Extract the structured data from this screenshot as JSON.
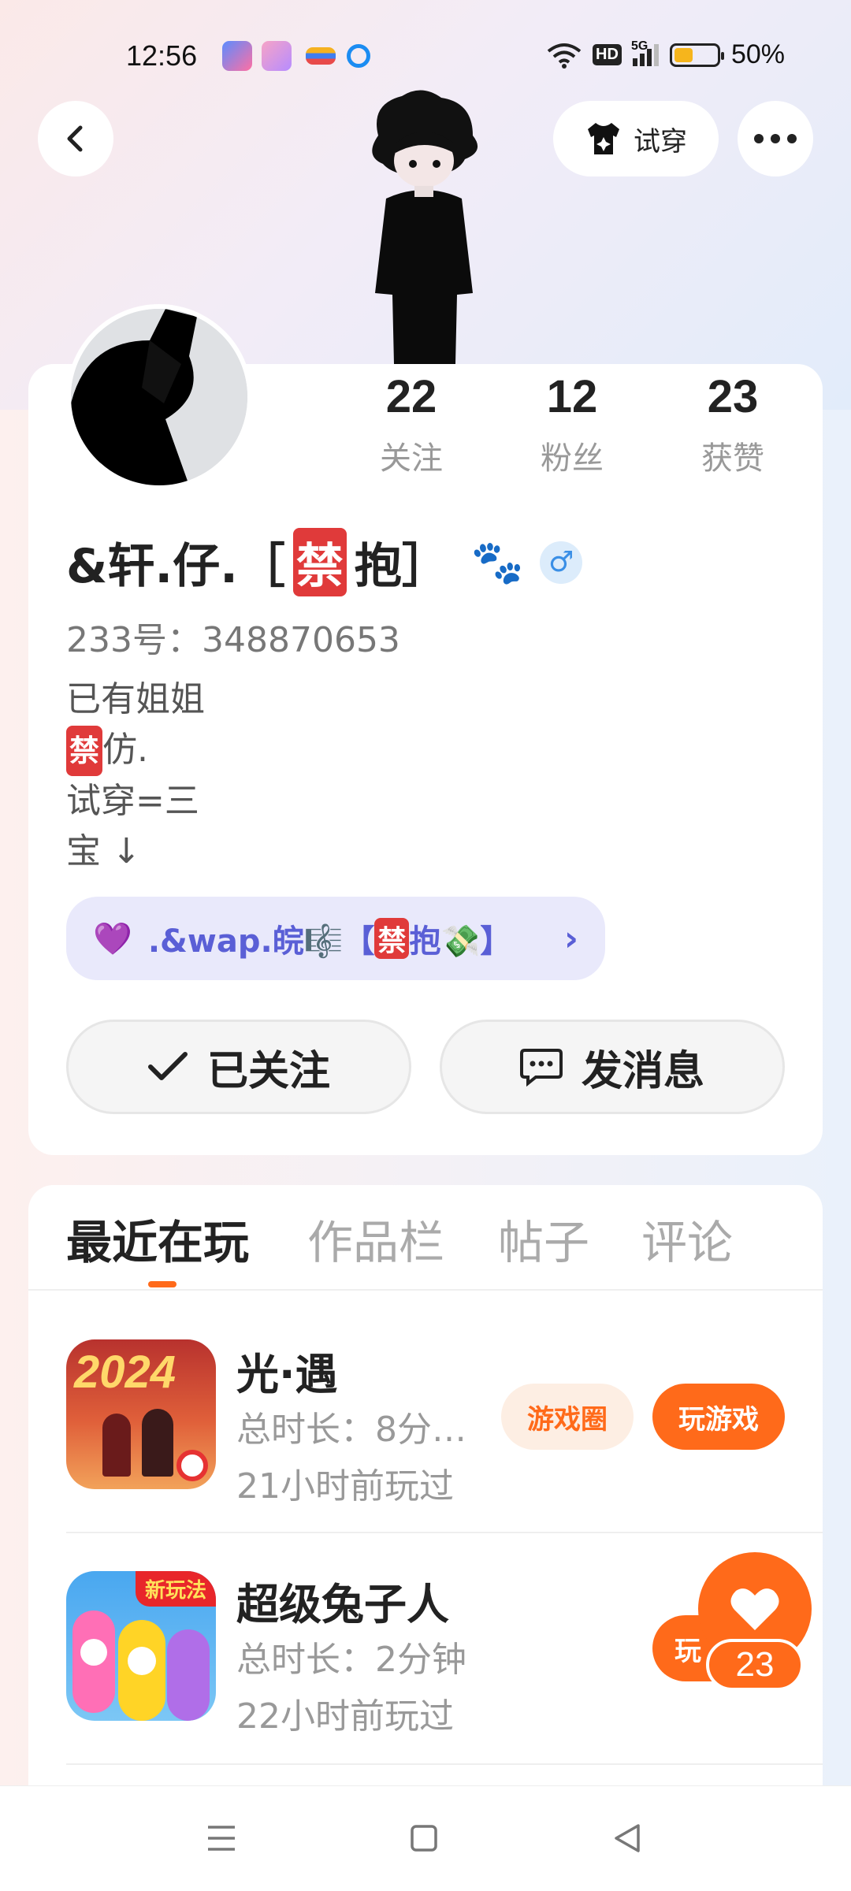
{
  "status_bar": {
    "time": "12:56",
    "network": "5G",
    "hd": "HD",
    "battery_percent": "50%",
    "battery_level": 0.5
  },
  "header": {
    "try_on_label": "试穿"
  },
  "profile": {
    "stats": [
      {
        "count": "22",
        "label": "关注"
      },
      {
        "count": "12",
        "label": "粉丝"
      },
      {
        "count": "23",
        "label": "获赞"
      }
    ],
    "nickname_prefix": "&轩.仔.［",
    "nickname_ban": "禁",
    "nickname_suffix": "抱］",
    "nickname_emoji": "🐾",
    "gender_symbol": "♂",
    "uid": "233号：348870653",
    "bio": {
      "line1": "已有姐姐",
      "line2_ban": "禁",
      "line2_text": "仿.",
      "line3": "试穿=三",
      "line4": "宝 ↓"
    },
    "badge": {
      "heart": "💜",
      "text_before": ".&wap.皖🎼【",
      "ban": "禁",
      "text_after": "抱💸】",
      "chevron": "›"
    },
    "follow_label": "已关注",
    "message_label": "发消息"
  },
  "tabs": [
    "最近在玩",
    "作品栏",
    "帖子",
    "评论"
  ],
  "games": [
    {
      "name": "光·遇",
      "duration": "总时长：8分…",
      "last_played": "21小时前玩过",
      "circle_label": "游戏圈",
      "play_label": "玩游戏",
      "icon_text": "2024"
    },
    {
      "name": "超级兔子人",
      "duration": "总时长：2分钟",
      "last_played": "22小时前玩过",
      "play_label_partial": "玩",
      "icon_text": "新玩法"
    }
  ],
  "like": {
    "count": "23"
  },
  "colors": {
    "accent": "#ff6a1a",
    "chip_light_bg": "#fdeee3",
    "badge_bg": "#e9e9fb",
    "badge_text": "#5a5fd6",
    "ban_red": "#e03a3a"
  }
}
